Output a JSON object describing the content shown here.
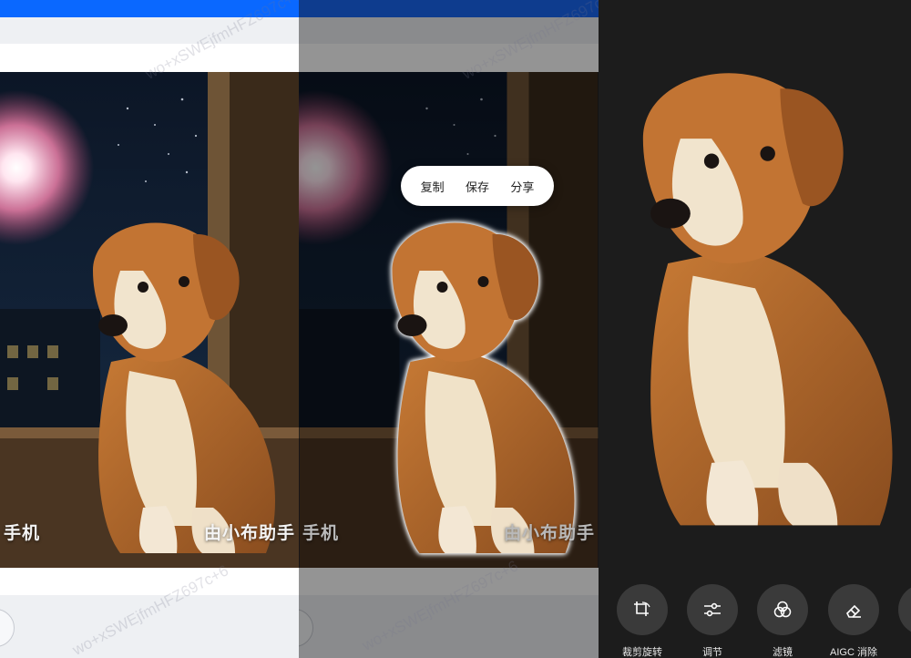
{
  "panel_left": {
    "caption_left": "手机",
    "caption_right": "由小布助手",
    "watermark": "wo+xSWEjfmHFZ697c+6"
  },
  "panel_middle": {
    "caption_left": "手机",
    "caption_right": "由小布助手",
    "context_menu": {
      "copy": "复制",
      "save": "保存",
      "share": "分享"
    },
    "watermark": "wo+xSWEjfmHFZ697c+6"
  },
  "panel_right": {
    "tools": [
      {
        "label": "裁剪旋转",
        "icon": "crop-rotate-icon"
      },
      {
        "label": "调节",
        "icon": "adjust-sliders-icon"
      },
      {
        "label": "滤镜",
        "icon": "filter-icon"
      },
      {
        "label": "AIGC 消除",
        "icon": "eraser-icon"
      }
    ]
  },
  "colors": {
    "accent_blue": "#0a68ff",
    "editor_bg": "#1c1c1c",
    "tool_circle": "#3a3a3a"
  }
}
